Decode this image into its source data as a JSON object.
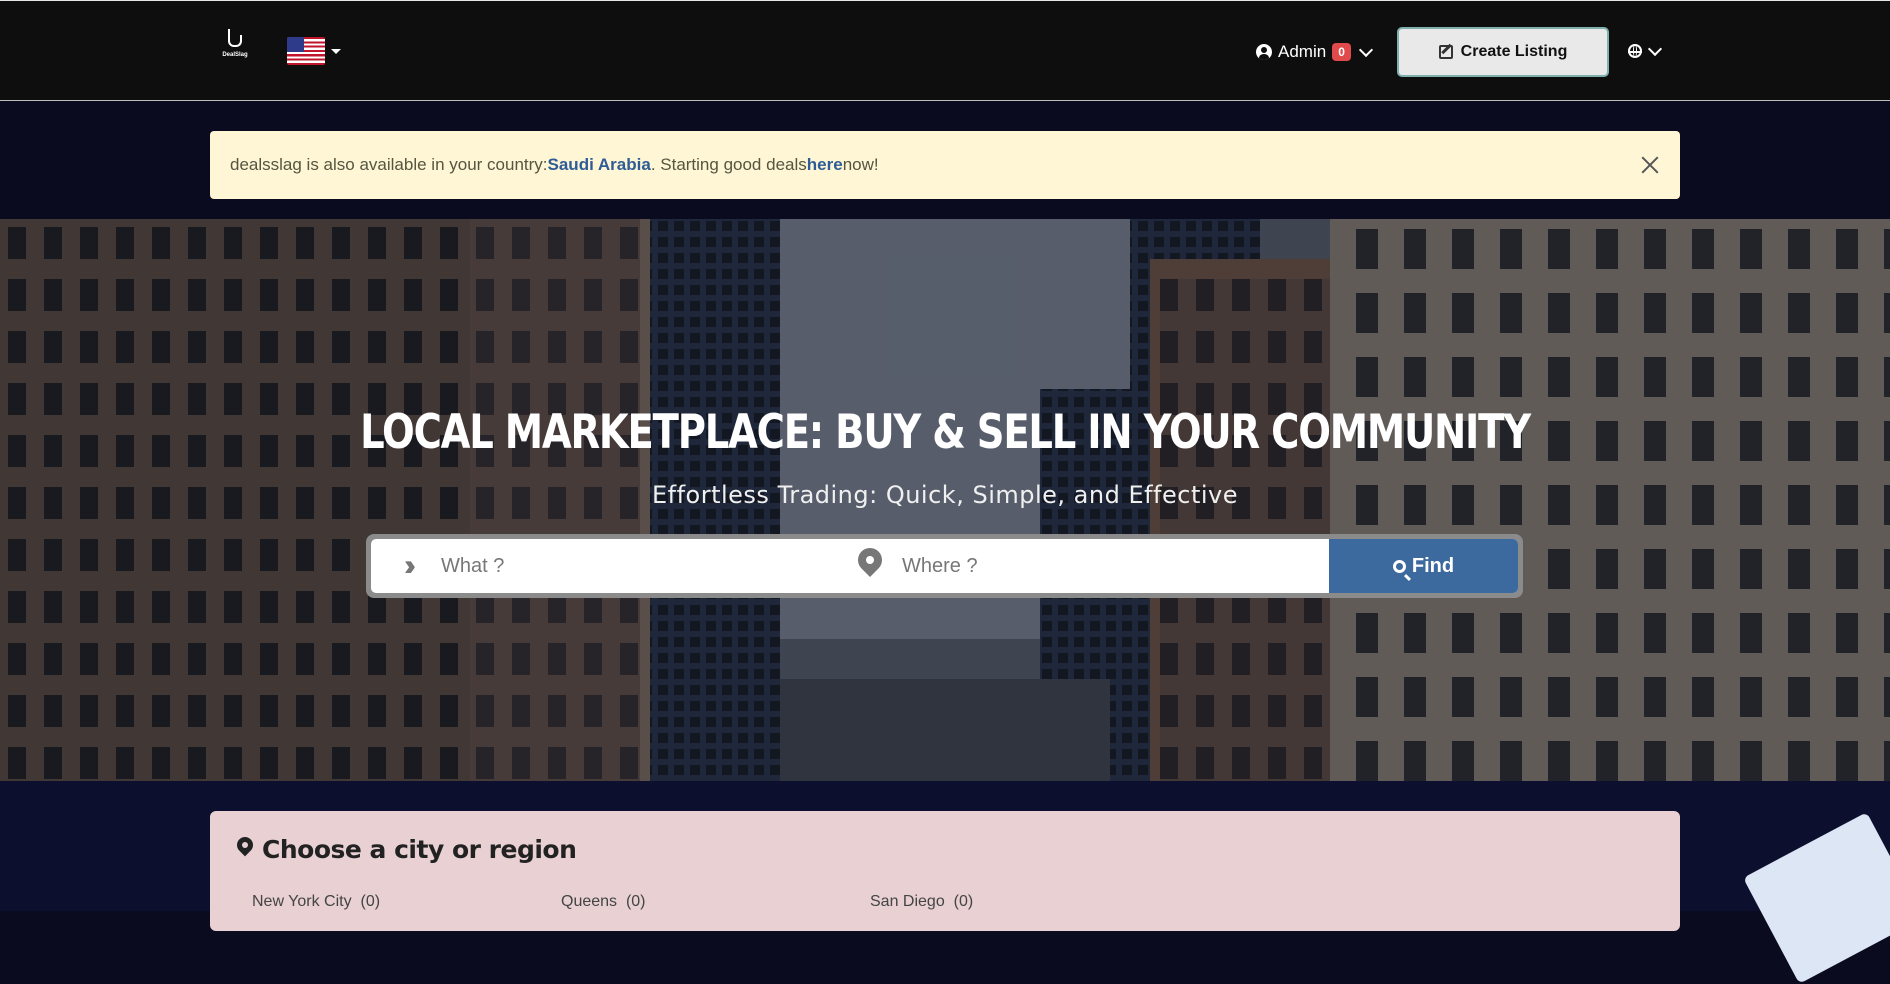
{
  "navbar": {
    "logo_text": "DealSlag",
    "user": {
      "name": "Admin",
      "notification_count": "0"
    },
    "create_listing_label": "Create Listing"
  },
  "alert": {
    "text_prefix": "dealsslag is also available in your country: ",
    "country_link": "Saudi Arabia",
    "text_middle": ". Starting good deals ",
    "here_link": "here",
    "text_suffix": " now!"
  },
  "hero": {
    "title": "LOCAL MARKETPLACE: BUY & SELL IN YOUR COMMUNITY",
    "subtitle": "Effortless Trading: Quick, Simple, and Effective",
    "what_placeholder": "What ?",
    "where_placeholder": "Where ?",
    "find_label": "Find"
  },
  "cities": {
    "title": "Choose a city or region",
    "items": [
      {
        "name": "New York City",
        "count": "(0)"
      },
      {
        "name": "Queens",
        "count": "(0)"
      },
      {
        "name": "San Diego",
        "count": "(0)"
      }
    ]
  },
  "colors": {
    "navbar_bg": "#0e0e0e",
    "alert_bg": "#fff6d6",
    "link": "#2e5c96",
    "find_button": "#3d6a9e",
    "badge": "#e04a4a",
    "city_panel": "#e8d0d3"
  }
}
